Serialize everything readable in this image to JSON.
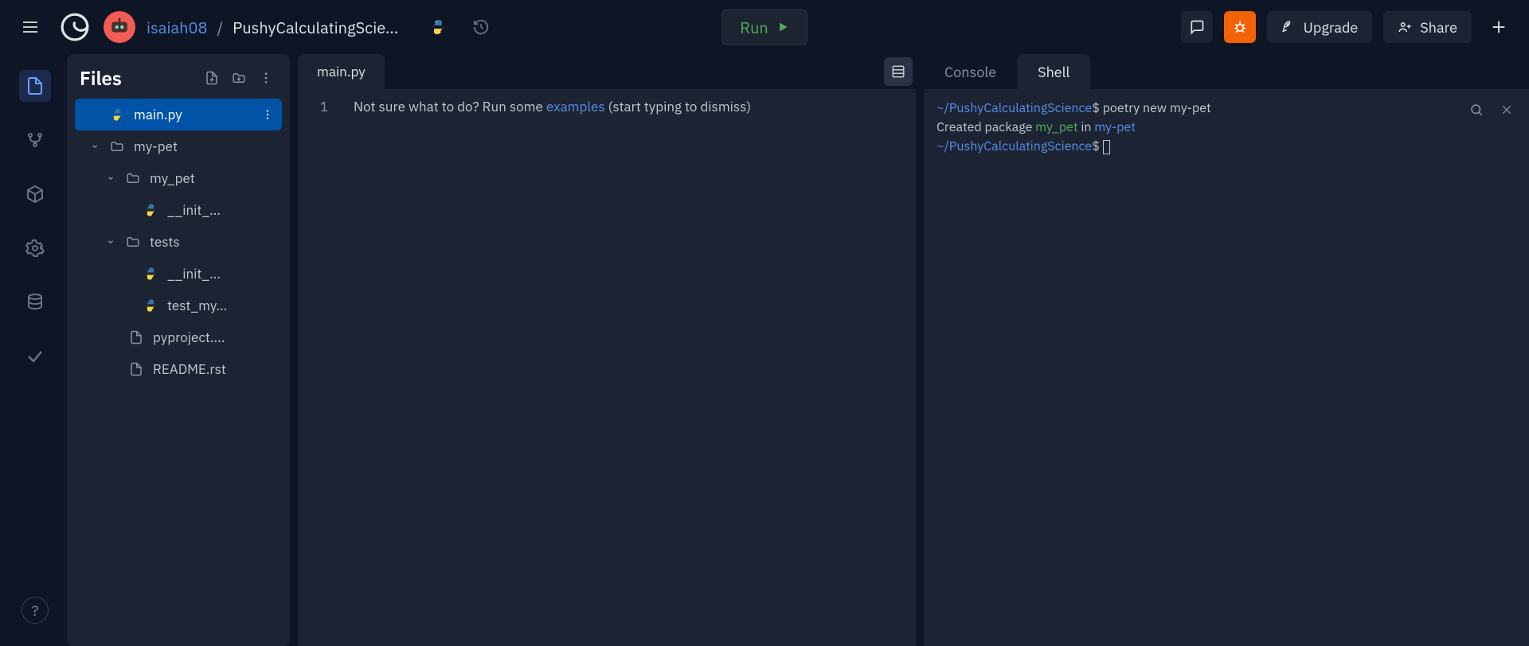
{
  "header": {
    "username": "isaiah08",
    "separator": "/",
    "project": "PushyCalculatingScie...",
    "run_label": "Run",
    "upgrade_label": "Upgrade",
    "share_label": "Share"
  },
  "sidebar": {
    "title": "Files",
    "help": "?"
  },
  "tree": {
    "items": [
      {
        "label": "main.py",
        "kind": "py",
        "indent": "ind-0",
        "selected": true,
        "chev": ""
      },
      {
        "label": "my-pet",
        "kind": "folder",
        "indent": "ind-1",
        "chev": "down"
      },
      {
        "label": "my_pet",
        "kind": "folder",
        "indent": "ind-2",
        "chev": "down"
      },
      {
        "label": "__init_...",
        "kind": "py",
        "indent": "ind-3",
        "chev": ""
      },
      {
        "label": "tests",
        "kind": "folder",
        "indent": "ind-2",
        "chev": "down"
      },
      {
        "label": "__init_...",
        "kind": "py",
        "indent": "ind-3",
        "chev": ""
      },
      {
        "label": "test_my...",
        "kind": "py",
        "indent": "ind-3",
        "chev": ""
      },
      {
        "label": "pyproject....",
        "kind": "file",
        "indent": "ind-3b",
        "chev": ""
      },
      {
        "label": "README.rst",
        "kind": "file",
        "indent": "ind-3b",
        "chev": ""
      }
    ]
  },
  "editor": {
    "tab": "main.py",
    "line_no": "1",
    "hint_prefix": "Not sure what to do? Run some ",
    "hint_link": "examples",
    "hint_suffix": " (start typing to dismiss)"
  },
  "terminal": {
    "tabs": {
      "console": "Console",
      "shell": "Shell"
    },
    "line1_path": "~/PushyCalculatingScience",
    "line1_prompt": "$",
    "line1_cmd": " poetry new my-pet",
    "line2_pre": "Created package ",
    "line2_pkg": "my_pet",
    "line2_mid": " in ",
    "line2_dir": "my-pet",
    "line3_path": "~/PushyCalculatingScience",
    "line3_prompt": "$"
  }
}
